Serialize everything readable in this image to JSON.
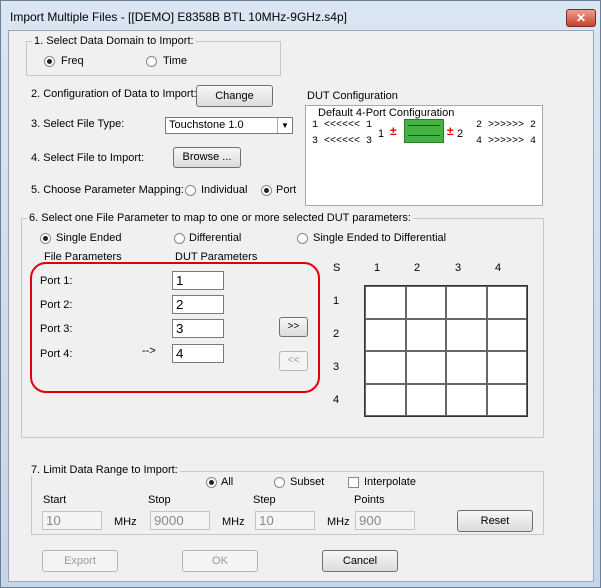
{
  "window": {
    "title": "Import Multiple Files - [[DEMO] E8358B BTL 10MHz-9GHz.s4p]"
  },
  "domain_group": {
    "legend": "1. Select Data Domain to Import:",
    "freq": "Freq",
    "time": "Time",
    "selected": "Freq"
  },
  "config": {
    "label": "2. Configuration of Data to Import:",
    "change_button": "Change"
  },
  "file_type": {
    "label": "3. Select File Type:",
    "value": "Touchstone 1.0"
  },
  "select_file": {
    "label": "4. Select File to Import:",
    "browse_button": "Browse ..."
  },
  "mapping": {
    "label": "5. Choose Parameter Mapping:",
    "individual": "Individual",
    "port": "Port",
    "selected": "Port"
  },
  "dut": {
    "title": "DUT Configuration",
    "subtitle": "Default 4-Port Configuration",
    "left_top": "1   <<<<<< 1",
    "left_bottom": "3   <<<<<< 3",
    "right_top": "2  >>>>>> 2",
    "right_bottom": "4  >>>>>> 4",
    "mid_left": "1",
    "mid_right": "2",
    "pm_left": "±",
    "pm_right": "±"
  },
  "param_group": {
    "legend": "6. Select one File Parameter to map to one or more selected DUT parameters:",
    "single": "Single Ended",
    "diff": "Differential",
    "s2d": "Single Ended to Differential",
    "selected": "Single Ended",
    "file_params": "File Parameters",
    "dut_params": "DUT Parameters",
    "ports": [
      {
        "label": "Port 1:",
        "value": "1"
      },
      {
        "label": "Port 2:",
        "value": "2"
      },
      {
        "label": "Port 3:",
        "value": "3"
      },
      {
        "label": "Port 4:",
        "value": "4"
      }
    ],
    "arrow": "-->",
    "add_button": ">>",
    "remove_button": "<<",
    "s_label": "S",
    "cols": [
      "1",
      "2",
      "3",
      "4"
    ],
    "rows": [
      "1",
      "2",
      "3",
      "4"
    ]
  },
  "range_group": {
    "legend": "7. Limit Data Range to Import:",
    "all": "All",
    "subset": "Subset",
    "interpolate": "Interpolate",
    "selected": "All",
    "start_label": "Start",
    "start_value": "10",
    "start_unit": "MHz",
    "stop_label": "Stop",
    "stop_value": "9000",
    "stop_unit": "MHz",
    "step_label": "Step",
    "step_value": "10",
    "step_unit": "MHz",
    "points_label": "Points",
    "points_value": "900",
    "reset_button": "Reset"
  },
  "footer": {
    "export": "Export",
    "ok": "OK",
    "cancel": "Cancel"
  },
  "colors": {
    "highlight": "#e00000",
    "dut_block": "#44b344"
  }
}
